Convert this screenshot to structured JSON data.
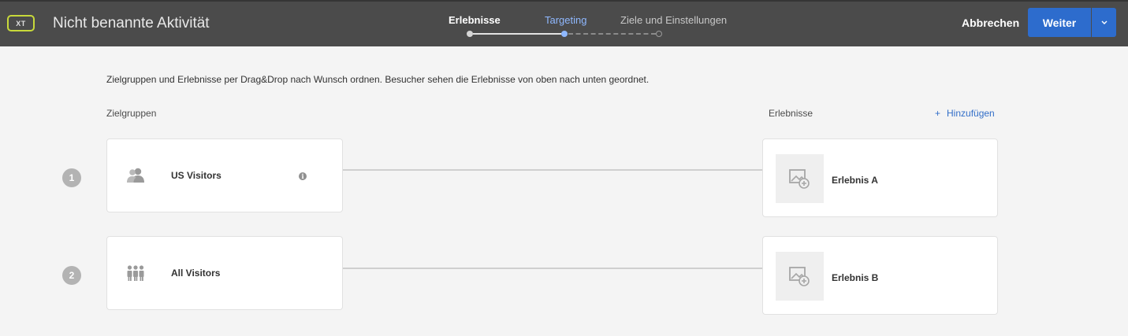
{
  "header": {
    "badge": "XT",
    "title": "Nicht benannte Aktivität",
    "steps": [
      {
        "label": "Erlebnisse",
        "state": "completed"
      },
      {
        "label": "Targeting",
        "state": "current"
      },
      {
        "label": "Ziele und Einstellungen",
        "state": "upcoming"
      }
    ],
    "cancel_label": "Abbrechen",
    "next_label": "Weiter",
    "next_menu_icon": "chevron-down-icon"
  },
  "main": {
    "instruction": "Zielgruppen und Erlebnisse per Drag&Drop nach Wunsch ordnen. Besucher sehen die Erlebnisse von oben nach unten geordnet.",
    "audiences_heading": "Zielgruppen",
    "experiences_heading": "Erlebnisse",
    "add_plus": "+",
    "add_label": "Hinzufügen",
    "rows": [
      {
        "number": "1",
        "audience": "US Visitors",
        "audience_icon": "user-group-icon",
        "info_icon": "info-icon",
        "info_glyph": "i",
        "experience": "Erlebnis A",
        "experience_icon": "add-image-icon"
      },
      {
        "number": "2",
        "audience": "All Visitors",
        "audience_icon": "people-group-icon",
        "experience": "Erlebnis B",
        "experience_icon": "add-image-icon"
      }
    ]
  },
  "colors": {
    "header_bg": "#4b4b4b",
    "accent_blue": "#2d6ccd",
    "active_step": "#8fb8ff",
    "badge_border": "#c8d93a",
    "page_bg": "#f4f4f4"
  }
}
